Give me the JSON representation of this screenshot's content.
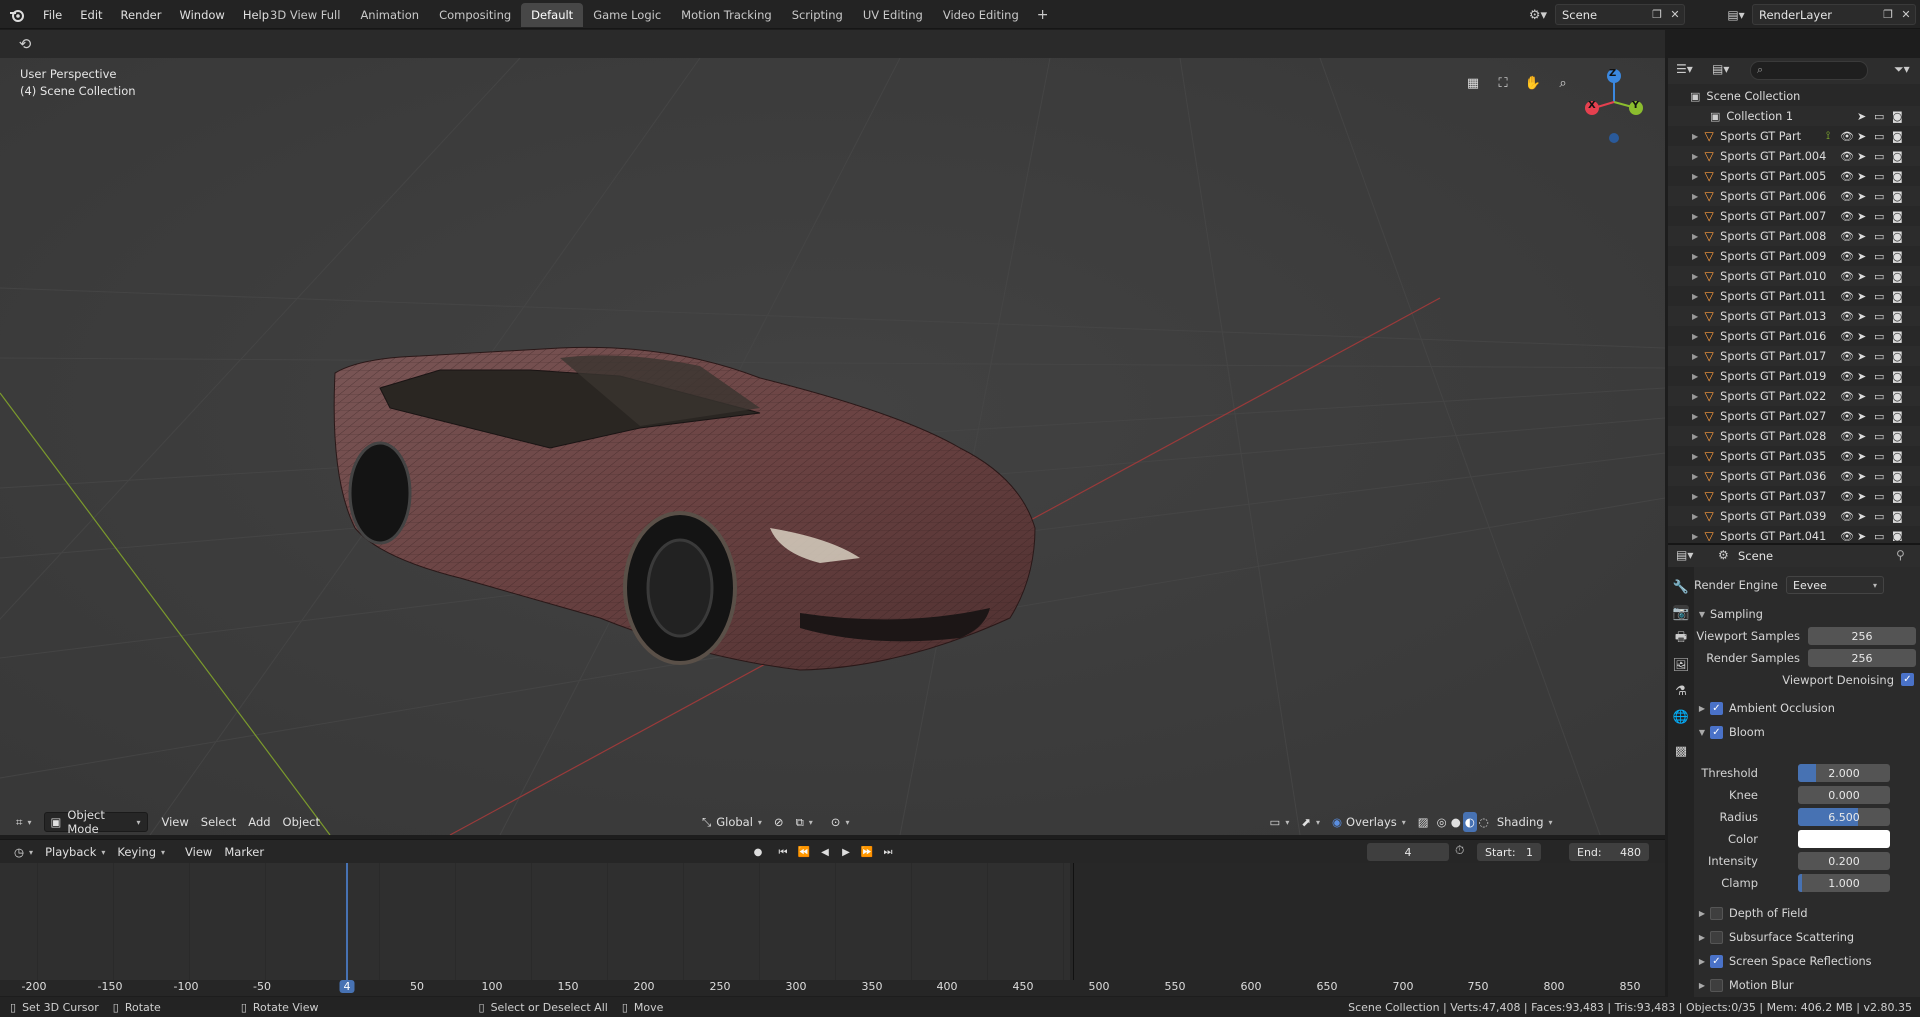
{
  "menu": [
    "File",
    "Edit",
    "Render",
    "Window",
    "Help"
  ],
  "workspaces": [
    "3D View Full",
    "Animation",
    "Compositing",
    "Default",
    "Game Logic",
    "Motion Tracking",
    "Scripting",
    "UV Editing",
    "Video Editing",
    "+"
  ],
  "active_workspace": "Default",
  "scene": {
    "label": "Scene"
  },
  "render_layer": {
    "label": "RenderLayer"
  },
  "viewport": {
    "perspective": "User Perspective",
    "collection": "(4) Scene Collection",
    "mode": "Object Mode",
    "menus": [
      "View",
      "Select",
      "Add",
      "Object"
    ],
    "transform": "Global",
    "overlays": "Overlays",
    "shading": "Shading",
    "gizmo": {
      "x": "X",
      "y": "Y",
      "z": "Z"
    }
  },
  "timeline": {
    "menus": [
      "Playback",
      "Keying",
      "View",
      "Marker"
    ],
    "current_frame": "4",
    "start_label": "Start:",
    "start": "1",
    "end_label": "End:",
    "end": "480",
    "ticks": [
      "-200",
      "-150",
      "-100",
      "-50",
      "4",
      "50",
      "100",
      "150",
      "200",
      "250",
      "300",
      "350",
      "400",
      "450",
      "500",
      "550",
      "600",
      "650",
      "700",
      "750",
      "800",
      "850"
    ]
  },
  "outliner": {
    "root": "Scene Collection",
    "collection": "Collection 1",
    "items": [
      "Sports GT Part",
      "Sports GT Part.004",
      "Sports GT Part.005",
      "Sports GT Part.006",
      "Sports GT Part.007",
      "Sports GT Part.008",
      "Sports GT Part.009",
      "Sports GT Part.010",
      "Sports GT Part.011",
      "Sports GT Part.013",
      "Sports GT Part.016",
      "Sports GT Part.017",
      "Sports GT Part.019",
      "Sports GT Part.022",
      "Sports GT Part.027",
      "Sports GT Part.028",
      "Sports GT Part.035",
      "Sports GT Part.036",
      "Sports GT Part.037",
      "Sports GT Part.039",
      "Sports GT Part.041"
    ]
  },
  "properties": {
    "context": "Scene",
    "render_engine_label": "Render Engine",
    "render_engine": "Eevee",
    "sampling": "Sampling",
    "viewport_samples_label": "Viewport Samples",
    "viewport_samples": "256",
    "render_samples_label": "Render Samples",
    "render_samples": "256",
    "viewport_denoising": "Viewport Denoising",
    "ambient_occlusion": "Ambient Occlusion",
    "bloom": "Bloom",
    "threshold_label": "Threshold",
    "threshold": "2.000",
    "knee_label": "Knee",
    "knee": "0.000",
    "radius_label": "Radius",
    "radius": "6.500",
    "color_label": "Color",
    "intensity_label": "Intensity",
    "intensity": "0.200",
    "clamp_label": "Clamp",
    "clamp": "1.000",
    "depth_of_field": "Depth of Field",
    "subsurface": "Subsurface Scattering",
    "ssr": "Screen Space Reflections",
    "motion_blur": "Motion Blur"
  },
  "status": {
    "set_cursor": "Set 3D Cursor",
    "rotate": "Rotate",
    "rotate_view": "Rotate View",
    "select_all": "Select or Deselect All",
    "move": "Move",
    "stats": "Scene Collection | Verts:47,408 | Faces:93,483 | Tris:93,483 | Objects:0/35 | Mem: 406.2 MB | v2.80.35"
  },
  "colors": {
    "accent": "#4772b3",
    "orange": "#ff9c3d",
    "axis_x": "#e5404f",
    "axis_y": "#8bbd2e",
    "axis_z": "#3b88e0"
  }
}
